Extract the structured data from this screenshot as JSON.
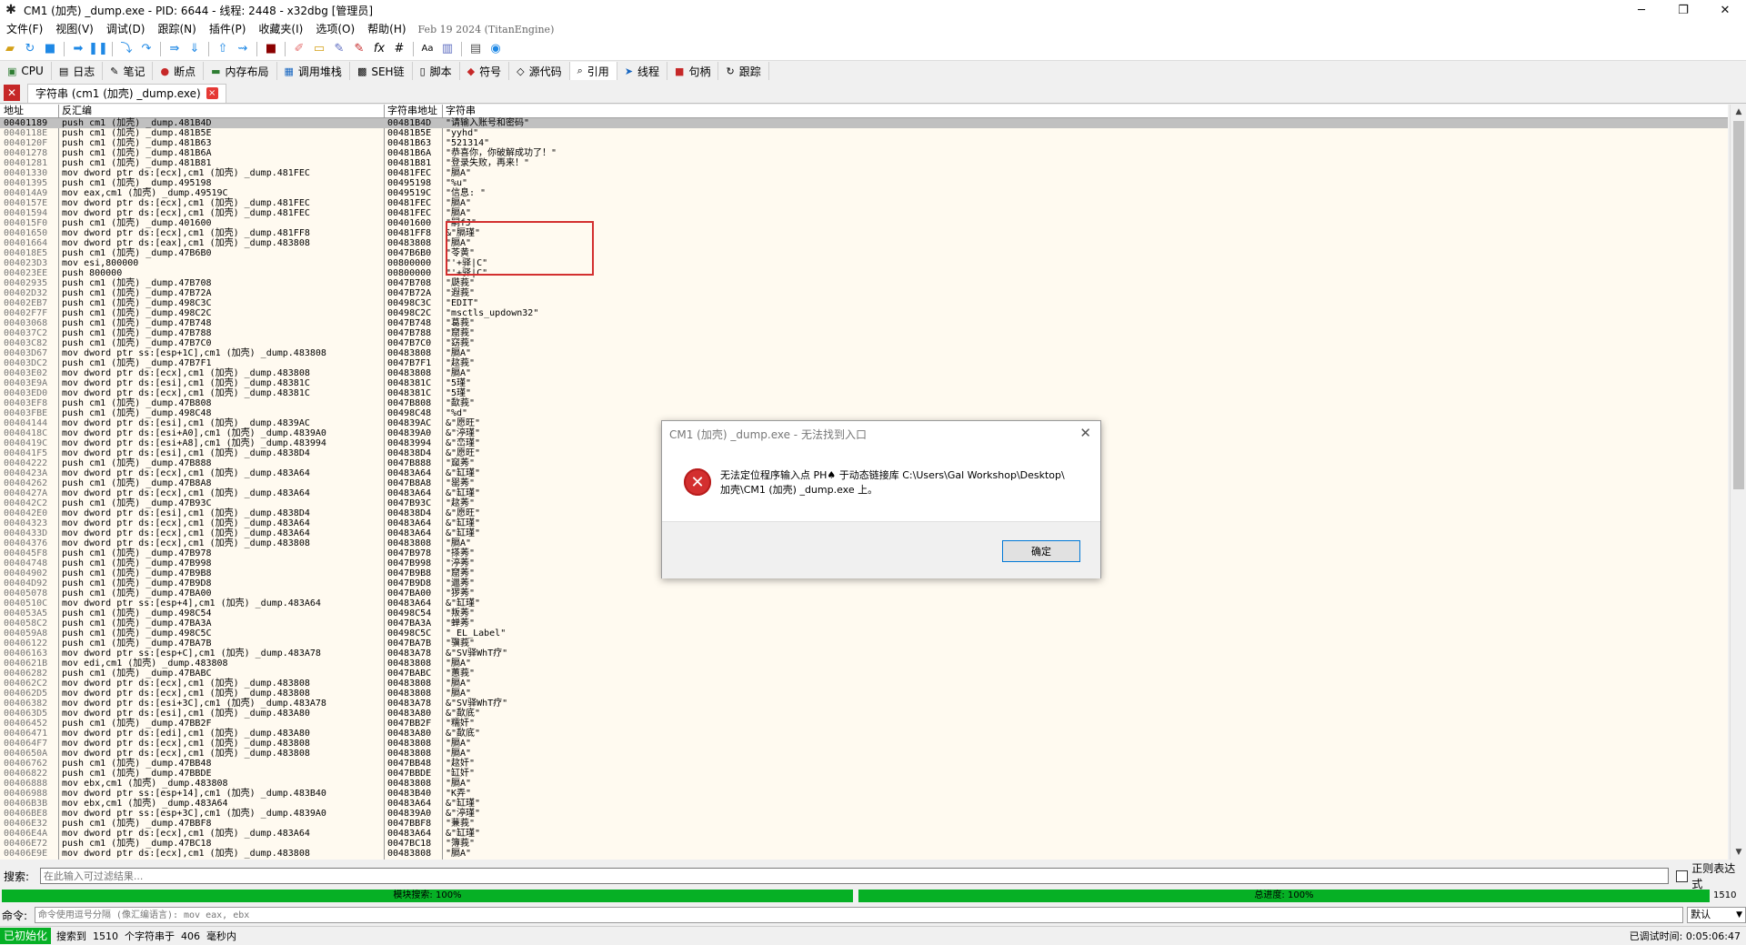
{
  "window": {
    "title": "CM1 (加壳) _dump.exe - PID: 6644 - 线程: 2448 - x32dbg [管理员]",
    "minimize": "─",
    "maximize": "❐",
    "close": "✕"
  },
  "menu": {
    "items": [
      "文件(F)",
      "视图(V)",
      "调试(D)",
      "跟踪(N)",
      "插件(P)",
      "收藏夹(I)",
      "选项(O)",
      "帮助(H)"
    ],
    "date": "Feb 19 2024 (TitanEngine)"
  },
  "tabs": [
    {
      "icon": "▣",
      "label": "CPU"
    },
    {
      "icon": "▤",
      "label": "日志"
    },
    {
      "icon": "✎",
      "label": "笔记"
    },
    {
      "icon": "●",
      "label": "断点"
    },
    {
      "icon": "▬",
      "label": "内存布局"
    },
    {
      "icon": "▦",
      "label": "调用堆栈"
    },
    {
      "icon": "▩",
      "label": "SEH链"
    },
    {
      "icon": "▯",
      "label": "脚本"
    },
    {
      "icon": "◆",
      "label": "符号"
    },
    {
      "icon": "◇",
      "label": "源代码"
    },
    {
      "icon": "⌕",
      "label": "引用"
    },
    {
      "icon": "➤",
      "label": "线程"
    },
    {
      "icon": "■",
      "label": "句柄"
    },
    {
      "icon": "↻",
      "label": "跟踪"
    }
  ],
  "subtab": {
    "close": "✕",
    "label": "字符串 (cm1 (加壳) _dump.exe)",
    "x": "×"
  },
  "grid": {
    "headers": {
      "addr": "地址",
      "dis": "反汇编",
      "saddr": "字符串地址",
      "str": "字符串"
    },
    "rows": [
      [
        "00401189",
        "push cm1 (加壳) _dump.481B4D",
        "00481B4D",
        "\"请输入账号和密码\""
      ],
      [
        "0040118E",
        "push cm1 (加壳) _dump.481B5E",
        "00481B5E",
        "\"yyhd\""
      ],
      [
        "0040120F",
        "push cm1 (加壳) _dump.481B63",
        "00481B63",
        "\"521314\""
      ],
      [
        "00401278",
        "push cm1 (加壳) _dump.481B6A",
        "00481B6A",
        "\"恭喜你，你破解成功了！\""
      ],
      [
        "00401281",
        "push cm1 (加壳) _dump.481B81",
        "00481B81",
        "\"登录失败，再来！\""
      ],
      [
        "00401330",
        "mov dword ptr ds:[ecx],cm1 (加壳) _dump.481FEC",
        "00481FEC",
        "\"膈A\""
      ],
      [
        "00401395",
        "push cm1 (加壳) _dump.495198",
        "00495198",
        "\"%u\""
      ],
      [
        "004014A9",
        "mov eax,cm1 (加壳) _dump.49519C",
        "0049519C",
        "\"信息: \""
      ],
      [
        "0040157E",
        "mov dword ptr ds:[ecx],cm1 (加壳) _dump.481FEC",
        "00481FEC",
        "\"膈A\""
      ],
      [
        "00401594",
        "mov dword ptr ds:[ecx],cm1 (加壳) _dump.481FEC",
        "00481FEC",
        "\"膈A\""
      ],
      [
        "004015F0",
        "push cm1 (加壳) _dump.401600",
        "00401600",
        "\"嗣fJ\""
      ],
      [
        "00401650",
        "mov dword ptr ds:[ecx],cm1 (加壳) _dump.481FF8",
        "00481FF8",
        "&\"膈瑾\""
      ],
      [
        "00401664",
        "mov dword ptr ds:[eax],cm1 (加壳) _dump.483808",
        "00483808",
        "\"膈A\""
      ],
      [
        "004018E5",
        "push cm1 (加壳) _dump.47B6B0",
        "0047B6B0",
        "\"苓黄\""
      ],
      [
        "004023D3",
        "mov esi,800000",
        "00800000",
        "\"'+驿|C\""
      ],
      [
        "004023EE",
        "push 800000",
        "00800000",
        "\"'+驿|C\""
      ],
      [
        "00402935",
        "push cm1 (加壳) _dump.47B708",
        "0047B708",
        "\"瓞莪\""
      ],
      [
        "00402D32",
        "push cm1 (加壳) _dump.47B72A",
        "0047B72A",
        "\"遐莪\""
      ],
      [
        "00402EB7",
        "push cm1 (加壳) _dump.498C3C",
        "00498C3C",
        "\"EDIT\""
      ],
      [
        "00402F7F",
        "push cm1 (加壳) _dump.498C2C",
        "00498C2C",
        "\"msctls_updown32\""
      ],
      [
        "00403068",
        "push cm1 (加壳) _dump.47B748",
        "0047B748",
        "\"葛莪\""
      ],
      [
        "004037C2",
        "push cm1 (加壳) _dump.47B788",
        "0047B788",
        "\"窟莪\""
      ],
      [
        "00403C82",
        "push cm1 (加壳) _dump.47B7C0",
        "0047B7C0",
        "\"窈莪\""
      ],
      [
        "00403D67",
        "mov dword ptr ss:[esp+1C],cm1 (加壳) _dump.483808",
        "00483808",
        "\"膈A\""
      ],
      [
        "00403DC2",
        "push cm1 (加壳) _dump.47B7F1",
        "0047B7F1",
        "\"趑莪\""
      ],
      [
        "00403E02",
        "mov dword ptr ds:[ecx],cm1 (加壳) _dump.483808",
        "00483808",
        "\"膈A\""
      ],
      [
        "00403E9A",
        "mov dword ptr ds:[esi],cm1 (加壳) _dump.48381C",
        "0048381C",
        "\"5瑾\""
      ],
      [
        "00403ED0",
        "mov dword ptr ds:[ecx],cm1 (加壳) _dump.48381C",
        "0048381C",
        "\"5瑾\""
      ],
      [
        "00403EF8",
        "push cm1 (加壳) _dump.47B808",
        "0047B808",
        "\"歃莪\""
      ],
      [
        "00403FBE",
        "push cm1 (加壳) _dump.498C48",
        "00498C48",
        "\"%d\""
      ],
      [
        "00404144",
        "mov dword ptr ds:[esi],cm1 (加壳) _dump.4839AC",
        "004839AC",
        "&\"愿旺\""
      ],
      [
        "0040418C",
        "mov dword ptr ds:[esi+A0],cm1 (加壳) _dump.4839A0",
        "004839A0",
        "&\"渟瑾\""
      ],
      [
        "0040419C",
        "mov dword ptr ds:[esi+A8],cm1 (加壳) _dump.483994",
        "00483994",
        "&\"峦瑾\""
      ],
      [
        "004041F5",
        "mov dword ptr ds:[esi],cm1 (加壳) _dump.4838D4",
        "004838D4",
        "&\"愿旺\""
      ],
      [
        "00404222",
        "push cm1 (加壳) _dump.47B888",
        "0047B888",
        "\"窳莠\""
      ],
      [
        "0040423A",
        "mov dword ptr ds:[ecx],cm1 (加壳) _dump.483A64",
        "00483A64",
        "&\"缸瑾\""
      ],
      [
        "00404262",
        "push cm1 (加壳) _dump.47B8A8",
        "0047B8A8",
        "\"罂莠\""
      ],
      [
        "0040427A",
        "mov dword ptr ds:[ecx],cm1 (加壳) _dump.483A64",
        "00483A64",
        "&\"缸瑾\""
      ],
      [
        "004042C2",
        "push cm1 (加壳) _dump.47B93C",
        "0047B93C",
        "\"趑莠\""
      ],
      [
        "004042E0",
        "mov dword ptr ds:[esi],cm1 (加壳) _dump.4838D4",
        "004838D4",
        "&\"愿旺\""
      ],
      [
        "00404323",
        "mov dword ptr ds:[ecx],cm1 (加壳) _dump.483A64",
        "00483A64",
        "&\"缸瑾\""
      ],
      [
        "0040433D",
        "mov dword ptr ds:[ecx],cm1 (加壳) _dump.483A64",
        "00483A64",
        "&\"缸瑾\""
      ],
      [
        "00404376",
        "mov dword ptr ds:[ecx],cm1 (加壳) _dump.483808",
        "00483808",
        "\"膈A\""
      ],
      [
        "004045F8",
        "push cm1 (加壳) _dump.47B978",
        "0047B978",
        "\"搽莠\""
      ],
      [
        "00404748",
        "push cm1 (加壳) _dump.47B998",
        "0047B998",
        "\"渟莠\""
      ],
      [
        "00404902",
        "push cm1 (加壳) _dump.47B9B8",
        "0047B9B8",
        "\"窟莠\""
      ],
      [
        "00404D92",
        "push cm1 (加壳) _dump.47B9D8",
        "0047B9D8",
        "\"邋莠\""
      ],
      [
        "00405078",
        "push cm1 (加壳) _dump.47BA00",
        "0047BA00",
        "\"猡莠\""
      ],
      [
        "0040510C",
        "mov dword ptr ss:[esp+4],cm1 (加壳) _dump.483A64",
        "00483A64",
        "&\"缸瑾\""
      ],
      [
        "004053A5",
        "push cm1 (加壳) _dump.498C54",
        "00498C54",
        "\"叛莠\""
      ],
      [
        "004058C2",
        "push cm1 (加壳) _dump.47BA3A",
        "0047BA3A",
        "\"蝉莠\""
      ],
      [
        "004059A8",
        "push cm1 (加壳) _dump.498C5C",
        "00498C5C",
        "\"_EL_Label\""
      ],
      [
        "00406122",
        "push cm1 (加壳) _dump.47BA7B",
        "0047BA7B",
        "\"骥莪\""
      ],
      [
        "00406163",
        "mov dword ptr ss:[esp+C],cm1 (加壳) _dump.483A78",
        "00483A78",
        "&\"SV驿WhT疗\""
      ],
      [
        "0040621B",
        "mov edi,cm1 (加壳) _dump.483808",
        "00483808",
        "\"膈A\""
      ],
      [
        "00406282",
        "push cm1 (加壳) _dump.47BABC",
        "0047BABC",
        "\"蕙莪\""
      ],
      [
        "004062C2",
        "mov dword ptr ds:[ecx],cm1 (加壳) _dump.483808",
        "00483808",
        "\"膈A\""
      ],
      [
        "004062D5",
        "mov dword ptr ds:[ecx],cm1 (加壳) _dump.483808",
        "00483808",
        "\"膈A\""
      ],
      [
        "00406382",
        "mov dword ptr ds:[esi+3C],cm1 (加壳) _dump.483A78",
        "00483A78",
        "&\"SV驿WhT疗\""
      ],
      [
        "004063D5",
        "mov dword ptr ds:[esi],cm1 (加壳) _dump.483A80",
        "00483A80",
        "&\"歃底\""
      ],
      [
        "00406452",
        "push cm1 (加壳) _dump.47BB2F",
        "0047BB2F",
        "\"糯奸\""
      ],
      [
        "00406471",
        "mov dword ptr ds:[edi],cm1 (加壳) _dump.483A80",
        "00483A80",
        "&\"歃底\""
      ],
      [
        "004064F7",
        "mov dword ptr ds:[ecx],cm1 (加壳) _dump.483808",
        "00483808",
        "\"膈A\""
      ],
      [
        "0040650A",
        "mov dword ptr ds:[ecx],cm1 (加壳) _dump.483808",
        "00483808",
        "\"膈A\""
      ],
      [
        "00406762",
        "push cm1 (加壳) _dump.47BB48",
        "0047BB48",
        "\"趑奸\""
      ],
      [
        "00406822",
        "push cm1 (加壳) _dump.47BBDE",
        "0047BBDE",
        "\"缸奸\""
      ],
      [
        "00406888",
        "mov ebx,cm1 (加壳) _dump.483808",
        "00483808",
        "\"膈A\""
      ],
      [
        "00406988",
        "mov dword ptr ss:[esp+14],cm1 (加壳) _dump.483B40",
        "00483B40",
        "\"K弄\""
      ],
      [
        "00406B3B",
        "mov ebx,cm1 (加壳) _dump.483A64",
        "00483A64",
        "&\"缸瑾\""
      ],
      [
        "00406BE8",
        "mov dword ptr ss:[esp+3C],cm1 (加壳) _dump.4839A0",
        "004839A0",
        "&\"渟瑾\""
      ],
      [
        "00406E32",
        "push cm1 (加壳) _dump.47BBF8",
        "0047BBF8",
        "\"蒹莪\""
      ],
      [
        "00406E4A",
        "mov dword ptr ds:[ecx],cm1 (加壳) _dump.483A64",
        "00483A64",
        "&\"缸瑾\""
      ],
      [
        "00406E72",
        "push cm1 (加壳) _dump.47BC18",
        "0047BC18",
        "\"簿莪\""
      ],
      [
        "00406E9E",
        "mov dword ptr ds:[ecx],cm1 (加壳) _dump.483808",
        "00483808",
        "\"膈A\""
      ]
    ]
  },
  "dialog": {
    "title": "CM1 (加壳) _dump.exe - 无法找到入口",
    "close": "✕",
    "icon": "✕",
    "message_line1": "无法定位程序输入点 PH♠ 于动态链接库 C:\\Users\\Gal Workshop\\Desktop\\",
    "message_line2": "加壳\\CM1 (加壳) _dump.exe 上。",
    "ok": "确定"
  },
  "search": {
    "label": "搜索:",
    "placeholder": "在此输入可过滤结果...",
    "regex_label": "正则表达式"
  },
  "progress": {
    "module_label": "模块搜索: 100%",
    "total_label": "总进度: 100%",
    "module": 1.0,
    "total": 1.0,
    "count": "1510"
  },
  "command": {
    "label": "命令:",
    "placeholder": "命令使用逗号分隔 (像汇编语言): mov eax, ebx",
    "mode": "默认",
    "arrow": "▼"
  },
  "status": {
    "state": "已初始化",
    "message": "搜索到  1510  个字符串于  406  毫秒内",
    "time": "已调试时间: 0:05:06:47"
  },
  "scroll": {
    "up": "▲",
    "down": "▼"
  },
  "colors": {
    "accent": "#0078d7",
    "progress": "#06b025",
    "highlight_box": "#d32f2f",
    "grid_bg": "#fffaf0",
    "error": "#d32f2f"
  }
}
